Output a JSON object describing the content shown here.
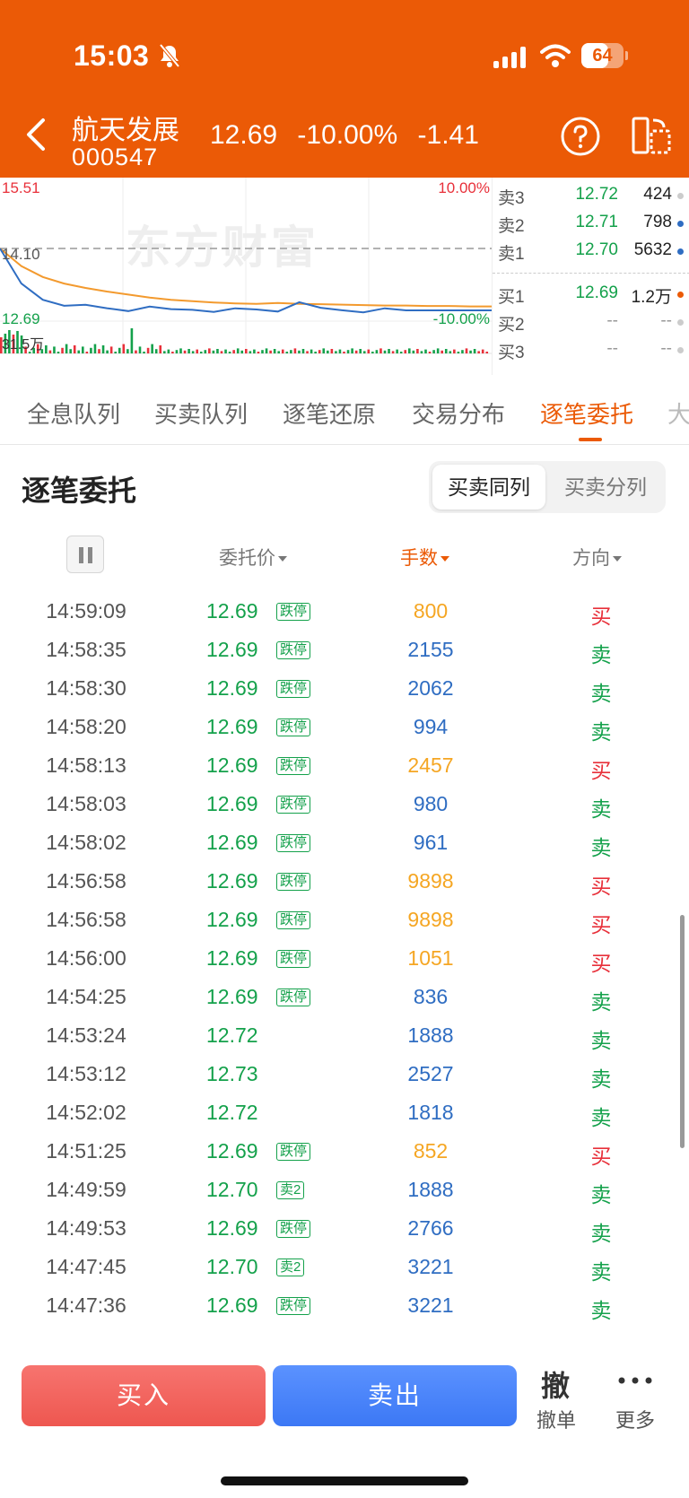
{
  "status_bar": {
    "time": "15:03",
    "battery": "64",
    "battery_level": 0.64
  },
  "header": {
    "stock_name": "航天发展",
    "stock_code": "000547",
    "price": "12.69",
    "change_pct": "-10.00%",
    "change": "-1.41"
  },
  "mini_chart": {
    "high_label": "15.51",
    "prev_close_label": "14.10",
    "low_label": "12.69",
    "upper_pct": "10.00%",
    "lower_pct": "-10.00%",
    "volume_label": "31.5万",
    "watermark": "东方财富"
  },
  "chart_data": {
    "type": "line",
    "ylim": [
      12.69,
      15.51
    ],
    "prev_close": 14.1,
    "series": [
      {
        "values": [
          14.1,
          13.7,
          13.45,
          13.3,
          13.2,
          13.12,
          13.05,
          12.98,
          12.93,
          12.9,
          12.87,
          12.85,
          12.84,
          12.86,
          12.84,
          12.83,
          12.82,
          12.81,
          12.8,
          12.8,
          12.79,
          12.79,
          12.78,
          12.78
        ]
      },
      {
        "values": [
          14.1,
          13.3,
          12.95,
          12.85,
          12.78,
          12.74,
          12.71,
          12.72,
          12.7,
          12.72,
          12.71,
          12.7,
          12.71,
          12.7,
          12.82,
          12.73,
          12.71,
          12.7,
          12.7,
          12.69,
          12.69,
          12.69,
          12.69,
          12.69
        ]
      }
    ]
  },
  "orderbook": {
    "asks": [
      {
        "label": "卖3",
        "price": "12.72",
        "volume": "424"
      },
      {
        "label": "卖2",
        "price": "12.71",
        "volume": "798"
      },
      {
        "label": "卖1",
        "price": "12.70",
        "volume": "5632"
      }
    ],
    "bids": [
      {
        "label": "买1",
        "price": "12.69",
        "volume": "1.2万"
      },
      {
        "label": "买2",
        "price": "--",
        "volume": "--"
      },
      {
        "label": "买3",
        "price": "--",
        "volume": "--"
      }
    ]
  },
  "tabs": [
    "全息队列",
    "买卖队列",
    "逐笔还原",
    "交易分布",
    "逐笔委托",
    "大"
  ],
  "section": {
    "title": "逐笔委托",
    "toggle": [
      "买卖同列",
      "买卖分列"
    ]
  },
  "table": {
    "headers": {
      "price": "委托价",
      "volume": "手数",
      "direction": "方向"
    },
    "rows": [
      {
        "time": "14:59:09",
        "price": "12.69",
        "tag": "跌停",
        "volume": "800",
        "dir": "买"
      },
      {
        "time": "14:58:35",
        "price": "12.69",
        "tag": "跌停",
        "volume": "2155",
        "dir": "卖"
      },
      {
        "time": "14:58:30",
        "price": "12.69",
        "tag": "跌停",
        "volume": "2062",
        "dir": "卖"
      },
      {
        "time": "14:58:20",
        "price": "12.69",
        "tag": "跌停",
        "volume": "994",
        "dir": "卖"
      },
      {
        "time": "14:58:13",
        "price": "12.69",
        "tag": "跌停",
        "volume": "2457",
        "dir": "买"
      },
      {
        "time": "14:58:03",
        "price": "12.69",
        "tag": "跌停",
        "volume": "980",
        "dir": "卖"
      },
      {
        "time": "14:58:02",
        "price": "12.69",
        "tag": "跌停",
        "volume": "961",
        "dir": "卖"
      },
      {
        "time": "14:56:58",
        "price": "12.69",
        "tag": "跌停",
        "volume": "9898",
        "dir": "买"
      },
      {
        "time": "14:56:58",
        "price": "12.69",
        "tag": "跌停",
        "volume": "9898",
        "dir": "买"
      },
      {
        "time": "14:56:00",
        "price": "12.69",
        "tag": "跌停",
        "volume": "1051",
        "dir": "买"
      },
      {
        "time": "14:54:25",
        "price": "12.69",
        "tag": "跌停",
        "volume": "836",
        "dir": "卖"
      },
      {
        "time": "14:53:24",
        "price": "12.72",
        "tag": "",
        "volume": "1888",
        "dir": "卖"
      },
      {
        "time": "14:53:12",
        "price": "12.73",
        "tag": "",
        "volume": "2527",
        "dir": "卖"
      },
      {
        "time": "14:52:02",
        "price": "12.72",
        "tag": "",
        "volume": "1818",
        "dir": "卖"
      },
      {
        "time": "14:51:25",
        "price": "12.69",
        "tag": "跌停",
        "volume": "852",
        "dir": "买"
      },
      {
        "time": "14:49:59",
        "price": "12.70",
        "tag": "卖2",
        "volume": "1888",
        "dir": "卖"
      },
      {
        "time": "14:49:53",
        "price": "12.69",
        "tag": "跌停",
        "volume": "2766",
        "dir": "卖"
      },
      {
        "time": "14:47:45",
        "price": "12.70",
        "tag": "卖2",
        "volume": "3221",
        "dir": "卖"
      },
      {
        "time": "14:47:36",
        "price": "12.69",
        "tag": "跌停",
        "volume": "3221",
        "dir": "卖"
      }
    ]
  },
  "bottom": {
    "buy": "买入",
    "sell": "卖出",
    "cancel_glyph": "撤",
    "cancel": "撤单",
    "more": "更多"
  },
  "colors": {
    "brand": "#EB5A06",
    "up": "#E8303A",
    "down": "#14A14B",
    "buy_volume": "#F5A623",
    "sell_volume": "#2F6DC2"
  }
}
